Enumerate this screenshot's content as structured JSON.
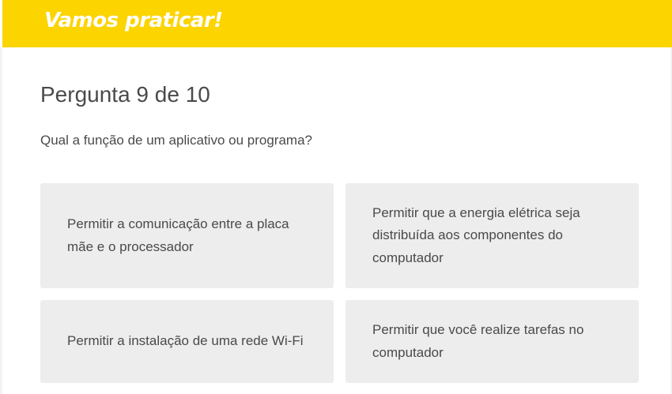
{
  "header": {
    "title": "Vamos praticar!"
  },
  "quiz": {
    "counter": "Pergunta 9 de 10",
    "question": "Qual a função de um aplicativo ou programa?",
    "options": [
      {
        "label": "Permitir a comunicação entre a placa mãe e o processador"
      },
      {
        "label": "Permitir que a energia elétrica seja distribuída aos componentes do computador"
      },
      {
        "label": "Permitir a instalação de uma rede Wi-Fi"
      },
      {
        "label": "Permitir que você realize tarefas no computador"
      }
    ]
  },
  "colors": {
    "header_bg": "#fcd400",
    "option_bg": "#ededed",
    "text": "#4a4a4a"
  }
}
